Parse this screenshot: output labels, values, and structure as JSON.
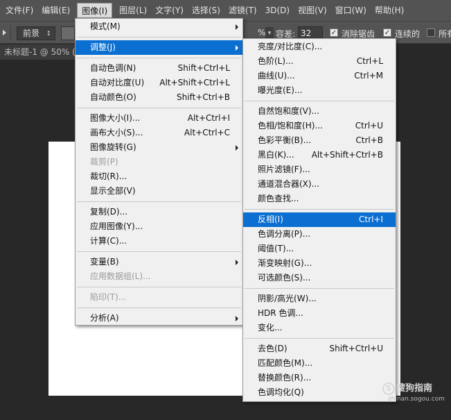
{
  "menubar": [
    {
      "label": "文件(F)"
    },
    {
      "label": "编辑(E)"
    },
    {
      "label": "图像(I)",
      "active": true
    },
    {
      "label": "图层(L)"
    },
    {
      "label": "文字(Y)"
    },
    {
      "label": "选择(S)"
    },
    {
      "label": "滤镜(T)"
    },
    {
      "label": "3D(D)"
    },
    {
      "label": "视图(V)"
    },
    {
      "label": "窗口(W)"
    },
    {
      "label": "帮助(H)"
    }
  ],
  "options": {
    "source_select": "前景",
    "opacity_suffix": "%",
    "tolerance_label": "容差:",
    "tolerance_value": "32",
    "antialias_label": "消除锯齿",
    "contiguous_label": "连续的",
    "all_layers_label": "所有"
  },
  "document_tab": "未标题-1 @ 50% (",
  "image_menu": [
    {
      "type": "item",
      "label": "模式(M)",
      "submenu": true
    },
    {
      "type": "divider"
    },
    {
      "type": "item",
      "label": "调整(J)",
      "submenu": true,
      "highlight": true
    },
    {
      "type": "divider"
    },
    {
      "type": "item",
      "label": "自动色调(N)",
      "shortcut": "Shift+Ctrl+L"
    },
    {
      "type": "item",
      "label": "自动对比度(U)",
      "shortcut": "Alt+Shift+Ctrl+L"
    },
    {
      "type": "item",
      "label": "自动颜色(O)",
      "shortcut": "Shift+Ctrl+B"
    },
    {
      "type": "divider"
    },
    {
      "type": "item",
      "label": "图像大小(I)...",
      "shortcut": "Alt+Ctrl+I"
    },
    {
      "type": "item",
      "label": "画布大小(S)...",
      "shortcut": "Alt+Ctrl+C"
    },
    {
      "type": "item",
      "label": "图像旋转(G)",
      "submenu": true
    },
    {
      "type": "item",
      "label": "裁剪(P)",
      "disabled": true
    },
    {
      "type": "item",
      "label": "裁切(R)..."
    },
    {
      "type": "item",
      "label": "显示全部(V)"
    },
    {
      "type": "divider"
    },
    {
      "type": "item",
      "label": "复制(D)..."
    },
    {
      "type": "item",
      "label": "应用图像(Y)..."
    },
    {
      "type": "item",
      "label": "计算(C)..."
    },
    {
      "type": "divider"
    },
    {
      "type": "item",
      "label": "变量(B)",
      "submenu": true
    },
    {
      "type": "item",
      "label": "应用数据组(L)...",
      "disabled": true
    },
    {
      "type": "divider"
    },
    {
      "type": "item",
      "label": "陷印(T)...",
      "disabled": true
    },
    {
      "type": "divider"
    },
    {
      "type": "item",
      "label": "分析(A)",
      "submenu": true
    }
  ],
  "adjust_menu": [
    {
      "type": "item",
      "label": "亮度/对比度(C)..."
    },
    {
      "type": "item",
      "label": "色阶(L)...",
      "shortcut": "Ctrl+L"
    },
    {
      "type": "item",
      "label": "曲线(U)...",
      "shortcut": "Ctrl+M"
    },
    {
      "type": "item",
      "label": "曝光度(E)..."
    },
    {
      "type": "divider"
    },
    {
      "type": "item",
      "label": "自然饱和度(V)..."
    },
    {
      "type": "item",
      "label": "色相/饱和度(H)...",
      "shortcut": "Ctrl+U"
    },
    {
      "type": "item",
      "label": "色彩平衡(B)...",
      "shortcut": "Ctrl+B"
    },
    {
      "type": "item",
      "label": "黑白(K)...",
      "shortcut": "Alt+Shift+Ctrl+B"
    },
    {
      "type": "item",
      "label": "照片滤镜(F)..."
    },
    {
      "type": "item",
      "label": "通道混合器(X)..."
    },
    {
      "type": "item",
      "label": "颜色查找..."
    },
    {
      "type": "divider"
    },
    {
      "type": "item",
      "label": "反相(I)",
      "shortcut": "Ctrl+I",
      "highlight": true
    },
    {
      "type": "item",
      "label": "色调分离(P)..."
    },
    {
      "type": "item",
      "label": "阈值(T)..."
    },
    {
      "type": "item",
      "label": "渐变映射(G)..."
    },
    {
      "type": "item",
      "label": "可选颜色(S)..."
    },
    {
      "type": "divider"
    },
    {
      "type": "item",
      "label": "阴影/高光(W)..."
    },
    {
      "type": "item",
      "label": "HDR 色调..."
    },
    {
      "type": "item",
      "label": "变化..."
    },
    {
      "type": "divider"
    },
    {
      "type": "item",
      "label": "去色(D)",
      "shortcut": "Shift+Ctrl+U"
    },
    {
      "type": "item",
      "label": "匹配颜色(M)..."
    },
    {
      "type": "item",
      "label": "替换颜色(R)..."
    },
    {
      "type": "item",
      "label": "色调均化(Q)"
    }
  ],
  "watermark": {
    "text": "搜狗指南",
    "sub": "zhinan.sogou.com"
  }
}
